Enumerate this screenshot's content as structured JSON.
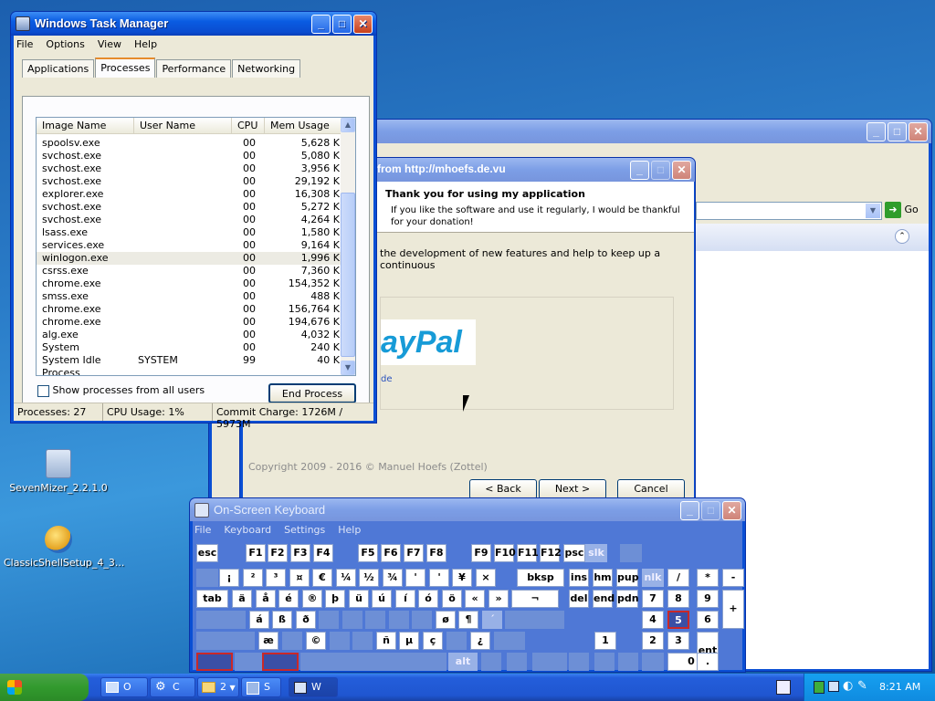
{
  "desktop": {
    "icons": [
      {
        "label": "SevenMizer_2.2.1.0"
      },
      {
        "label": "ClassicShellSetup_4_3..."
      }
    ]
  },
  "browser": {
    "go_label": "Go"
  },
  "installer": {
    "title": "from http://mhoefs.de.vu",
    "heading": "Thank you for using my application",
    "subtext": "If you like the software and use it regularly, I would be thankful for your donation!",
    "body": "the development of new features and help to keep up a continuous",
    "paypal": "ayPal",
    "link_fragment": "de",
    "copyright": "Copyright 2009 - 2016 © Manuel Hoefs (Zottel)",
    "back": "< Back",
    "next": "Next >",
    "cancel": "Cancel"
  },
  "taskmanager": {
    "title": "Windows Task Manager",
    "menu": [
      "File",
      "Options",
      "View",
      "Help"
    ],
    "tabs": [
      "Applications",
      "Processes",
      "Performance",
      "Networking"
    ],
    "columns": [
      "Image Name",
      "User Name",
      "CPU",
      "Mem Usage"
    ],
    "rows": [
      {
        "name": "spoolsv.exe",
        "user": "",
        "cpu": "00",
        "mem": "5,628 K"
      },
      {
        "name": "svchost.exe",
        "user": "",
        "cpu": "00",
        "mem": "5,080 K"
      },
      {
        "name": "svchost.exe",
        "user": "",
        "cpu": "00",
        "mem": "3,956 K"
      },
      {
        "name": "svchost.exe",
        "user": "",
        "cpu": "00",
        "mem": "29,192 K"
      },
      {
        "name": "explorer.exe",
        "user": "",
        "cpu": "00",
        "mem": "16,308 K"
      },
      {
        "name": "svchost.exe",
        "user": "",
        "cpu": "00",
        "mem": "5,272 K"
      },
      {
        "name": "svchost.exe",
        "user": "",
        "cpu": "00",
        "mem": "4,264 K"
      },
      {
        "name": "lsass.exe",
        "user": "",
        "cpu": "00",
        "mem": "1,580 K"
      },
      {
        "name": "services.exe",
        "user": "",
        "cpu": "00",
        "mem": "9,164 K"
      },
      {
        "name": "winlogon.exe",
        "user": "",
        "cpu": "00",
        "mem": "1,996 K"
      },
      {
        "name": "csrss.exe",
        "user": "",
        "cpu": "00",
        "mem": "7,360 K"
      },
      {
        "name": "chrome.exe",
        "user": "",
        "cpu": "00",
        "mem": "154,352 K"
      },
      {
        "name": "smss.exe",
        "user": "",
        "cpu": "00",
        "mem": "488 K"
      },
      {
        "name": "chrome.exe",
        "user": "",
        "cpu": "00",
        "mem": "156,764 K"
      },
      {
        "name": "chrome.exe",
        "user": "",
        "cpu": "00",
        "mem": "194,676 K"
      },
      {
        "name": "alg.exe",
        "user": "",
        "cpu": "00",
        "mem": "4,032 K"
      },
      {
        "name": "System",
        "user": "",
        "cpu": "00",
        "mem": "240 K"
      },
      {
        "name": "System Idle Process",
        "user": "SYSTEM",
        "cpu": "99",
        "mem": "40 K"
      }
    ],
    "show_all_label": "Show processes from all users",
    "end_process": "End Process",
    "status": {
      "processes": "Processes: 27",
      "cpu": "CPU Usage: 1%",
      "commit": "Commit Charge: 1726M / 5973M"
    }
  },
  "osk": {
    "title": "On-Screen Keyboard",
    "menu": [
      "File",
      "Keyboard",
      "Settings",
      "Help"
    ],
    "rows": [
      [
        "esc",
        "",
        "F1",
        "F2",
        "F3",
        "F4",
        "",
        "F5",
        "F6",
        "F7",
        "F8",
        "",
        "F9",
        "F10",
        "F11",
        "F12",
        "psc",
        "slk",
        ""
      ],
      [
        "",
        "¡",
        "²",
        "³",
        "¤",
        "€",
        "¼",
        "½",
        "¾",
        "'",
        "'",
        "¥",
        "×",
        "bksp",
        "ins",
        "hm",
        "pup",
        "nlk",
        "/",
        "*",
        "-"
      ],
      [
        "tab",
        "ä",
        "å",
        "é",
        "®",
        "þ",
        "ü",
        "ú",
        "í",
        "ó",
        "ö",
        "«",
        "»",
        "¬",
        "del",
        "end",
        "pdn",
        "7",
        "8",
        "9",
        "+"
      ],
      [
        "",
        "á",
        "ß",
        "ð",
        "",
        "",
        "",
        "",
        "",
        "ø",
        "¶",
        "´",
        "",
        "",
        "4",
        "5",
        "6"
      ],
      [
        "",
        "æ",
        "",
        "©",
        "",
        "",
        "ñ",
        "µ",
        "ç",
        "",
        "¿",
        "",
        "",
        "1",
        "2",
        "3",
        "ent"
      ],
      [
        "",
        "",
        "",
        "",
        "alt",
        "",
        "",
        "",
        "",
        "",
        "",
        "",
        "0",
        "."
      ]
    ]
  },
  "taskbar": {
    "start": "start",
    "buttons": [
      "O",
      "C",
      "2",
      "S",
      "W"
    ],
    "time": "8:21 AM"
  }
}
